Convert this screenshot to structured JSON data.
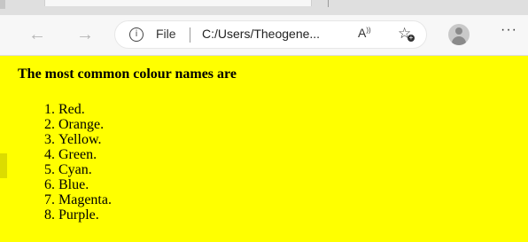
{
  "tabstrip": {
    "tab_glyph": "□",
    "close_glyph": "×"
  },
  "toolbar": {
    "back_glyph": "←",
    "forward_glyph": "→",
    "address": {
      "info_glyph": "i",
      "scheme_label": "File",
      "url": "C:/Users/Theogene...",
      "read_aloud_glyph": "A",
      "favorites_glyph": "☆",
      "favorites_plus": "+"
    },
    "menu_glyph": "···"
  },
  "page": {
    "background": "#ffff00",
    "heading": "The most common colour names are",
    "colours": [
      {
        "num": "1.",
        "name": "Red."
      },
      {
        "num": "2.",
        "name": "Orange."
      },
      {
        "num": "3.",
        "name": "Yellow."
      },
      {
        "num": "4.",
        "name": "Green."
      },
      {
        "num": "5.",
        "name": "Cyan."
      },
      {
        "num": "6.",
        "name": "Blue."
      },
      {
        "num": "7.",
        "name": "Magenta."
      },
      {
        "num": "8.",
        "name": "Purple."
      }
    ]
  }
}
